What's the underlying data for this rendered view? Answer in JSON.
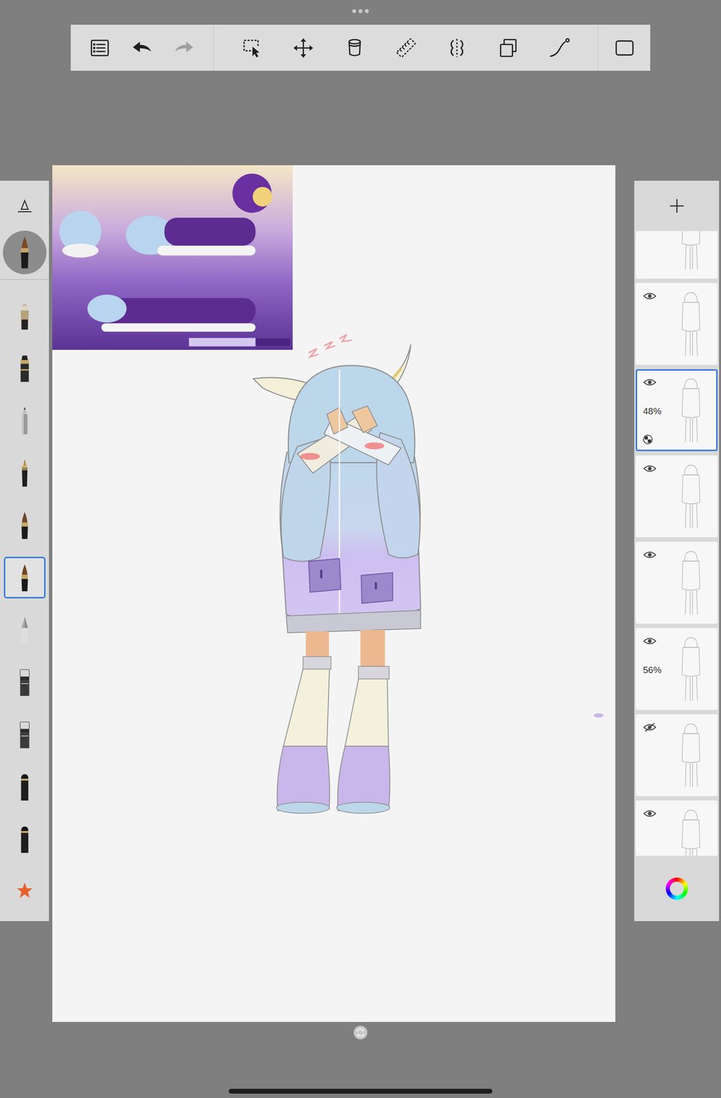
{
  "toolbar": {
    "groups": [
      [
        {
          "kind": "list",
          "disabled": false
        },
        {
          "kind": "undo",
          "disabled": false
        },
        {
          "kind": "redo",
          "disabled": true
        }
      ],
      [
        {
          "kind": "select",
          "disabled": false
        },
        {
          "kind": "transform",
          "disabled": false
        },
        {
          "kind": "fill",
          "disabled": false
        },
        {
          "kind": "ruler",
          "disabled": false
        },
        {
          "kind": "symmetry",
          "disabled": false
        },
        {
          "kind": "shapes",
          "disabled": false
        },
        {
          "kind": "stroke",
          "disabled": false
        }
      ],
      [
        {
          "kind": "fullscreen",
          "disabled": false
        }
      ]
    ]
  },
  "brush_panel": {
    "current_brush": "paintbrush",
    "brushes": [
      {
        "kind": "airbrush",
        "selected": false
      },
      {
        "kind": "marker",
        "selected": false
      },
      {
        "kind": "pencil",
        "selected": false
      },
      {
        "kind": "pen",
        "selected": false
      },
      {
        "kind": "paintbrush",
        "selected": false
      },
      {
        "kind": "paintbrush",
        "selected": true
      },
      {
        "kind": "chisel",
        "selected": false
      },
      {
        "kind": "eraser",
        "selected": false
      },
      {
        "kind": "eraser",
        "selected": false
      },
      {
        "kind": "blender",
        "selected": false
      },
      {
        "kind": "blender",
        "selected": false
      },
      {
        "kind": "favorites",
        "selected": false
      }
    ]
  },
  "layers": [
    {
      "visible": true,
      "selected": false,
      "opacity": null,
      "alpha_lock": false
    },
    {
      "visible": true,
      "selected": false,
      "opacity": null,
      "alpha_lock": false
    },
    {
      "visible": true,
      "selected": true,
      "opacity": "48%",
      "alpha_lock": true
    },
    {
      "visible": true,
      "selected": false,
      "opacity": null,
      "alpha_lock": false
    },
    {
      "visible": true,
      "selected": false,
      "opacity": null,
      "alpha_lock": false
    },
    {
      "visible": true,
      "selected": false,
      "opacity": "56%",
      "alpha_lock": false
    },
    {
      "visible": false,
      "selected": false,
      "opacity": null,
      "alpha_lock": false
    },
    {
      "visible": true,
      "selected": false,
      "opacity": null,
      "alpha_lock": false
    }
  ]
}
